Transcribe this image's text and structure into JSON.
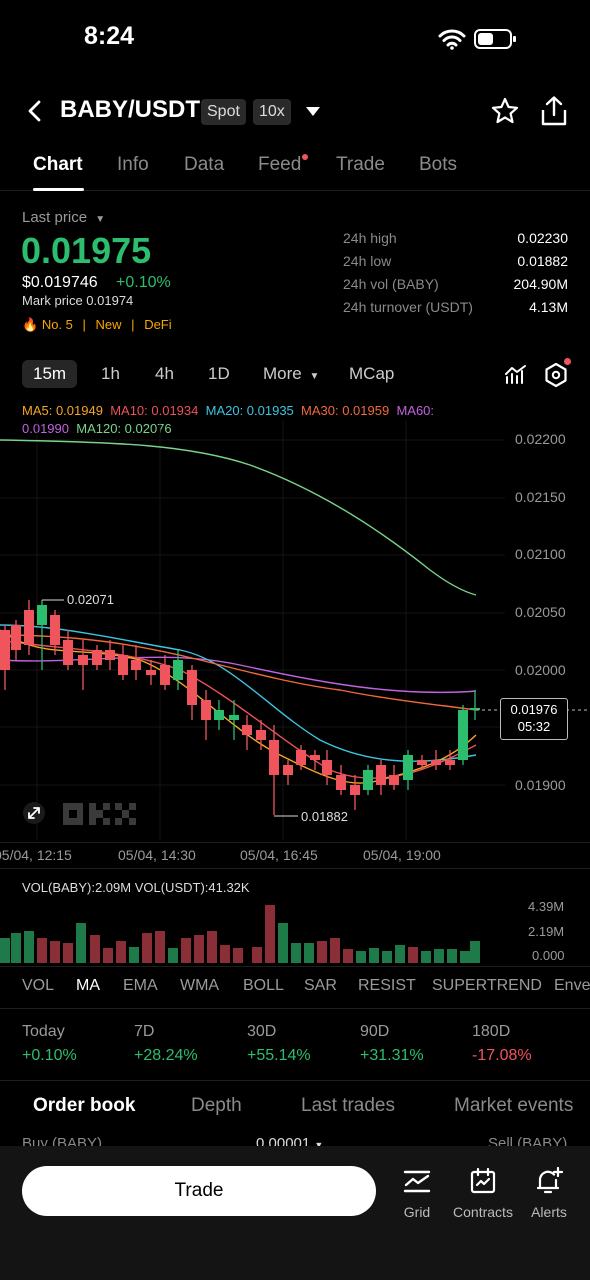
{
  "status": {
    "time": "8:24"
  },
  "header": {
    "pair": "BABY/USDT",
    "market_badge": "Spot",
    "leverage_badge": "10x"
  },
  "tabs": [
    "Chart",
    "Info",
    "Data",
    "Feed",
    "Trade",
    "Bots"
  ],
  "price": {
    "last_label": "Last price",
    "last": "0.01975",
    "usd": "$0.019746",
    "change": "+0.10%",
    "mark": "Mark price 0.01974",
    "tags": [
      "No. 5",
      "New",
      "DeFi"
    ],
    "tag_sep": "|"
  },
  "stats": [
    {
      "label": "24h high",
      "value": "0.02230"
    },
    {
      "label": "24h low",
      "value": "0.01882"
    },
    {
      "label": "24h vol (BABY)",
      "value": "204.90M"
    },
    {
      "label": "24h turnover (USDT)",
      "value": "4.13M"
    }
  ],
  "timeframes": [
    "15m",
    "1h",
    "4h",
    "1D",
    "More",
    "MCap"
  ],
  "ma": {
    "ma5": "MA5: 0.01949",
    "ma10": "MA10: 0.01934",
    "ma20": "MA20: 0.01935",
    "ma30": "MA30: 0.01959",
    "ma60a": "MA60:",
    "ma60b": "0.01990",
    "ma120": "MA120: 0.02076"
  },
  "yaxis": [
    "0.02200",
    "0.02150",
    "0.02100",
    "0.02050",
    "0.02000",
    "0.01900"
  ],
  "price_tag": {
    "value": "0.01976",
    "countdown": "05:32"
  },
  "annotations": {
    "high": "0.02071",
    "low": "0.01882"
  },
  "xaxis": [
    "05/04, 12:15",
    "05/04, 14:30",
    "05/04, 16:45",
    "05/04, 19:00"
  ],
  "volume": {
    "label": "VOL(BABY):2.09M VOL(USDT):41.32K",
    "axis": [
      "4.39M",
      "2.19M",
      "0.000"
    ]
  },
  "indicators": [
    "VOL",
    "MA",
    "EMA",
    "WMA",
    "BOLL",
    "SAR",
    "RESIST",
    "SUPERTREND",
    "Enve"
  ],
  "performance": [
    {
      "label": "Today",
      "value": "+0.10%",
      "dir": "up"
    },
    {
      "label": "7D",
      "value": "+28.24%",
      "dir": "up"
    },
    {
      "label": "30D",
      "value": "+55.14%",
      "dir": "up"
    },
    {
      "label": "90D",
      "value": "+31.31%",
      "dir": "up"
    },
    {
      "label": "180D",
      "value": "-17.08%",
      "dir": "down"
    }
  ],
  "orderbook": {
    "tabs": [
      "Order book",
      "Depth",
      "Last trades",
      "Market events"
    ],
    "buy": "Buy (BABY)",
    "step": "0.00001",
    "sell": "Sell (BABY)"
  },
  "bottom": {
    "trade": "Trade",
    "grid": "Grid",
    "contracts": "Contracts",
    "alerts": "Alerts"
  },
  "colors": {
    "up": "#2dbd6e",
    "down": "#f0555e",
    "tag": "#f7a600"
  }
}
